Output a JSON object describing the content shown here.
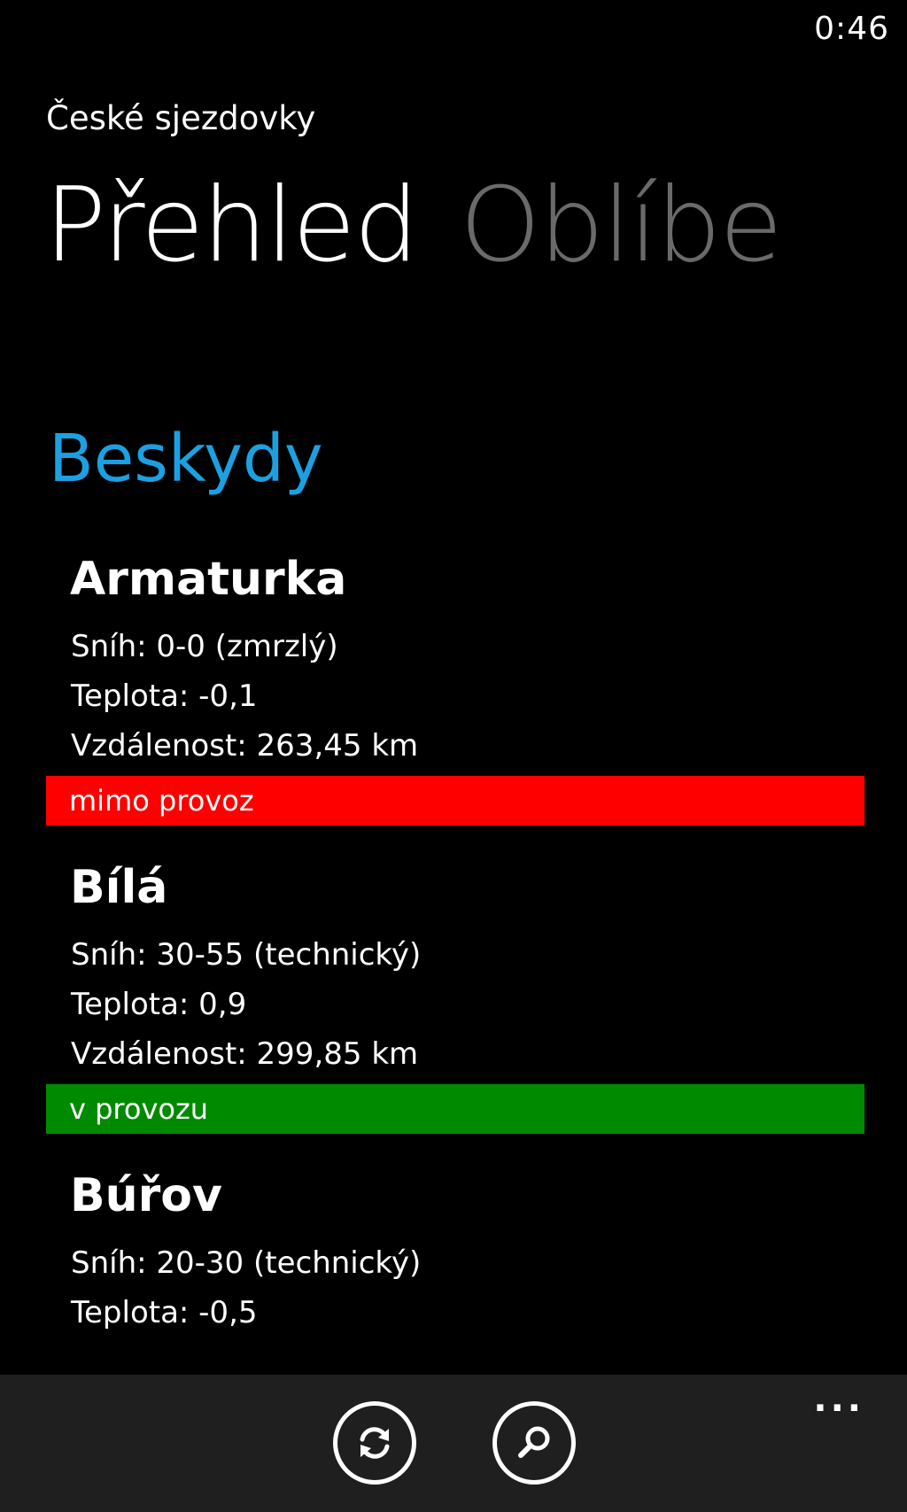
{
  "status_bar": {
    "time": "0:46"
  },
  "app": {
    "title": "České sjezdovky"
  },
  "pivot": {
    "items": [
      {
        "label": "Přehled",
        "active": true
      },
      {
        "label": "Oblíbe",
        "active": false
      }
    ]
  },
  "group": {
    "header": "Beskydy"
  },
  "resorts": [
    {
      "name": "Armaturka",
      "snow": "Sníh: 0-0 (zmrzlý)",
      "temperature": "Teplota: -0,1",
      "distance": "Vzdálenost: 263,45 km",
      "status": "mimo provoz",
      "status_color": "#ff0000"
    },
    {
      "name": "Bílá",
      "snow": "Sníh: 30-55 (technický)",
      "temperature": "Teplota: 0,9",
      "distance": "Vzdálenost: 299,85 km",
      "status": "v provozu",
      "status_color": "#008a00"
    },
    {
      "name": "Búřov",
      "snow": "Sníh: 20-30 (technický)",
      "temperature": "Teplota: -0,5"
    }
  ],
  "app_bar": {
    "buttons": [
      {
        "icon": "refresh-icon"
      },
      {
        "icon": "search-icon"
      }
    ],
    "more": "..."
  },
  "colors": {
    "accent": "#1ba1e2",
    "background": "#000000",
    "app_bar": "#1f1f1f",
    "closed": "#ff0000",
    "open": "#008a00"
  }
}
